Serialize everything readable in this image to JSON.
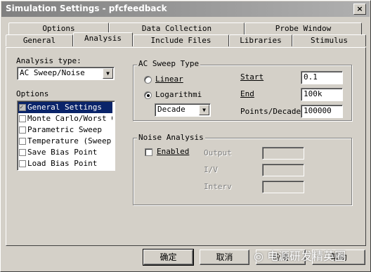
{
  "window": {
    "title": "Simulation Settings - pfcfeedback",
    "close_label": "×"
  },
  "tabs_back": [
    "Options",
    "Data Collection",
    "Probe Window"
  ],
  "tabs_front": [
    "General",
    "Analysis",
    "Include Files",
    "Libraries",
    "Stimulus"
  ],
  "active_tab": "Analysis",
  "analysis_type": {
    "label": "Analysis type:",
    "value": "AC Sweep/Noise"
  },
  "options": {
    "label": "Options",
    "items": [
      {
        "label": "General Settings",
        "checked": true,
        "selected": true
      },
      {
        "label": "Monte Carlo/Worst Cas",
        "checked": false,
        "selected": false
      },
      {
        "label": "Parametric Sweep",
        "checked": false,
        "selected": false
      },
      {
        "label": "Temperature (Sweep)",
        "checked": false,
        "selected": false
      },
      {
        "label": "Save Bias Point",
        "checked": false,
        "selected": false
      },
      {
        "label": "Load Bias Point",
        "checked": false,
        "selected": false
      }
    ]
  },
  "ac_sweep": {
    "group_title": "AC Sweep Type",
    "linear_label": "Linear",
    "log_label": "Logarithmi",
    "log_mode": "Decade",
    "start_label": "Start",
    "start_value": "0.1",
    "end_label": "End",
    "end_value": "100k",
    "points_label": "Points/Decade",
    "points_value": "100000"
  },
  "noise": {
    "group_title": "Noise Analysis",
    "enabled_label": "Enabled",
    "output_label": "Output",
    "iv_label": "I/V",
    "interval_label": "Interv"
  },
  "buttons": {
    "ok": "确定",
    "cancel": "取消",
    "apply": "应用",
    "help": "帮助"
  },
  "watermark": "电源研发精英圈"
}
